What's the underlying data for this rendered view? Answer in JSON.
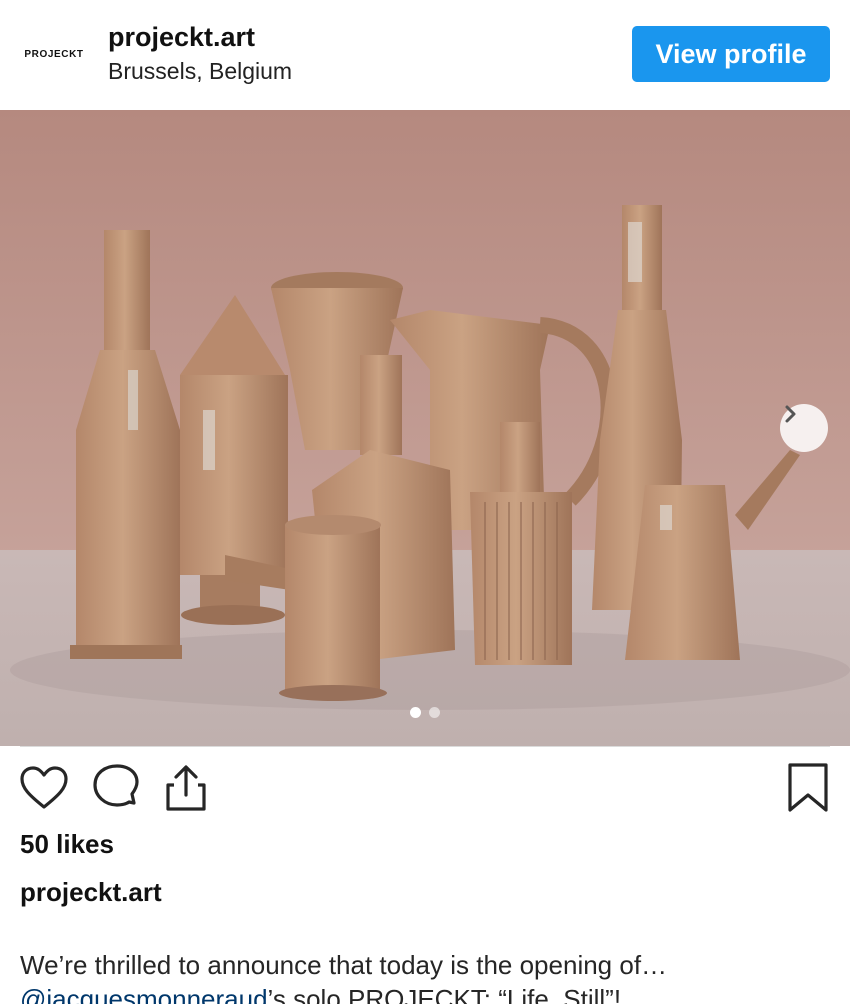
{
  "header": {
    "avatar_text": "PROJECKT",
    "username": "projeckt.art",
    "location": "Brussels, Belgium",
    "view_profile_label": "View profile"
  },
  "media": {
    "carousel_count": 2,
    "carousel_active_index": 0
  },
  "post": {
    "likes": "50 likes",
    "caption_username": "projeckt.art",
    "caption_line1": "We’re thrilled to announce that today is the opening of…",
    "caption_mention": "@jacquesmonneraud",
    "caption_line2_rest": "’s solo PROJECKT: “Life, Still”!"
  },
  "icons": {
    "like": "heart-icon",
    "comment": "comment-icon",
    "share": "share-icon",
    "save": "bookmark-icon",
    "next": "chevron-right-icon"
  },
  "colors": {
    "primary_button": "#1a96ee",
    "mention": "#00376b"
  }
}
